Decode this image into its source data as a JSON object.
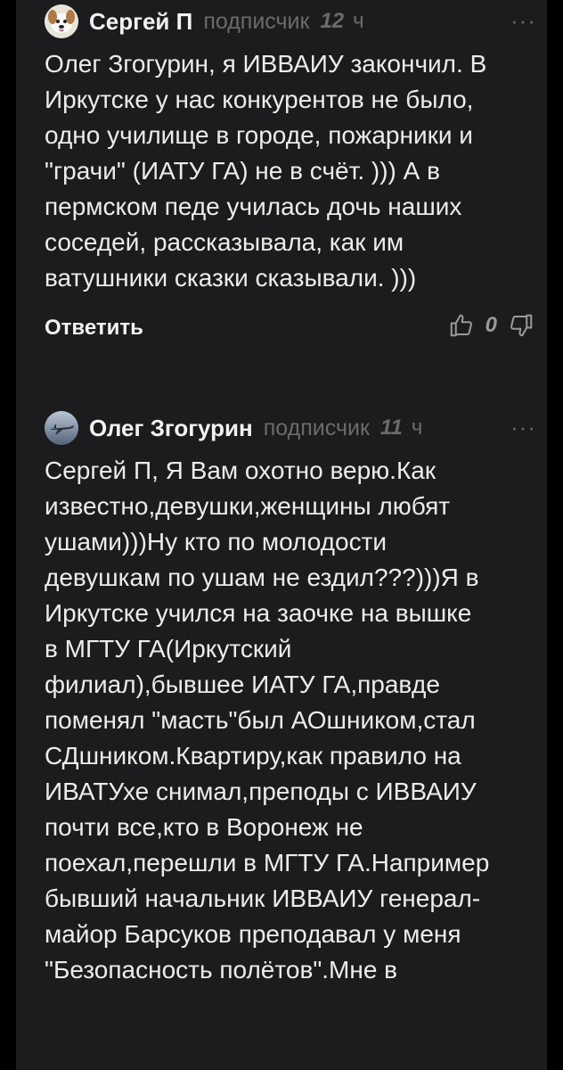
{
  "comments": [
    {
      "author": "Сергей П",
      "status": "подписчик",
      "time_value": "12",
      "time_unit": "ч",
      "more": "···",
      "text": "Олег Згогурин, я ИВВАИУ закончил. В\nИркутске у нас конкурентов не было,\nодно училище в городе, пожарники и\n\"грачи\" (ИАТУ ГА) не в счёт. ))) А в\nпермском педе училась дочь наших\nсоседей, рассказывала, как им\nватушники сказки сказывали. )))",
      "reply_label": "Ответить",
      "score": "0"
    },
    {
      "author": "Олег Згогурин",
      "status": "подписчик",
      "time_value": "11",
      "time_unit": "ч",
      "more": "···",
      "text": "Сергей П, Я Вам охотно верю.Как\nизвестно,девушки,женщины любят\nушами)))Ну кто по молодости\nдевушкам по ушам не ездил???)))Я в\nИркутске учился на заочке на вышке\nв МГТУ ГА(Иркутский\nфилиал),бывшее ИАТУ ГА,правде\nпоменял \"масть\"был АОшником,стал\nСДшником.Квартиру,как правило на\nИВАТУхе снимал,преподы с ИВВАИУ\nпочти все,кто в Воронеж не\nпоехал,перешли в МГТУ ГА.Например\nбывший начальник ИВВАИУ генерал-\nмайор Барсуков преподавал у меня\n\"Безопасность полётов\".Мне в"
    }
  ],
  "icons": {
    "avatar1": "dog-avatar",
    "avatar2": "airplane-avatar",
    "upvote": "thumbs-up-icon",
    "downvote": "thumbs-down-icon"
  },
  "colors": {
    "background": "#1c1c1e",
    "text": "#ececec",
    "muted": "#6b6b6e"
  }
}
